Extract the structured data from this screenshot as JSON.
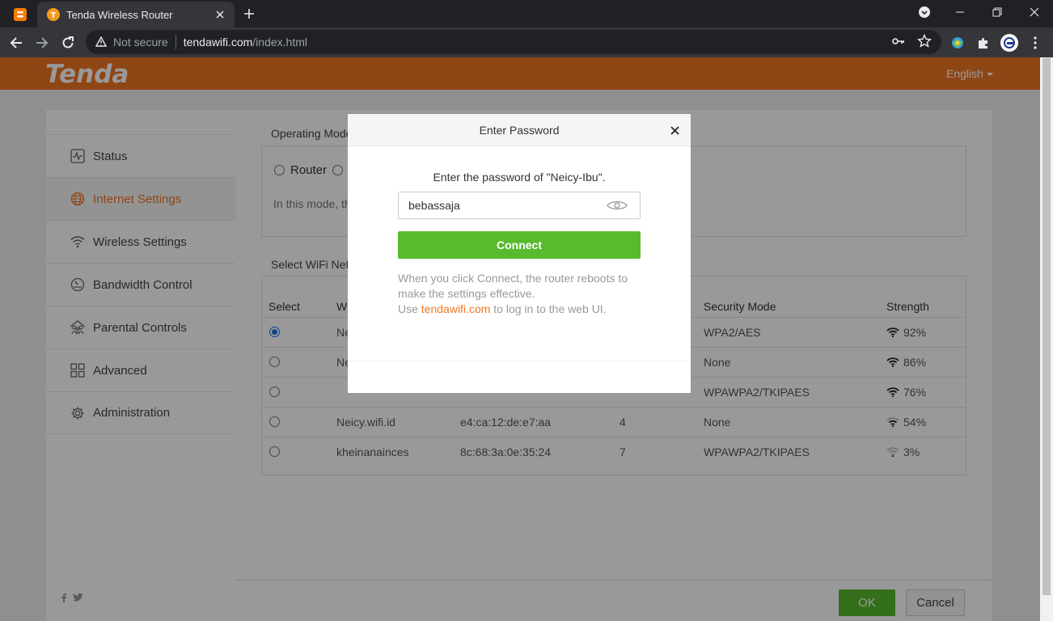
{
  "browser": {
    "tab_title": "Tenda Wireless Router",
    "security_label": "Not secure",
    "url_host": "tendawifi.com",
    "url_path": "/index.html"
  },
  "header": {
    "logo": "Tenda",
    "language": "English"
  },
  "sidebar": {
    "items": [
      {
        "label": "Status",
        "icon": "status-icon"
      },
      {
        "label": "Internet Settings",
        "icon": "globe-icon",
        "active": true
      },
      {
        "label": "Wireless Settings",
        "icon": "wifi-icon"
      },
      {
        "label": "Bandwidth Control",
        "icon": "gauge-icon"
      },
      {
        "label": "Parental Controls",
        "icon": "family-icon"
      },
      {
        "label": "Advanced",
        "icon": "grid-icon"
      },
      {
        "label": "Administration",
        "icon": "gear-icon"
      }
    ]
  },
  "main": {
    "operating_mode_title": "Operating Mode",
    "mode_router_label": "Router",
    "mode_hint": "In this mode, th",
    "wifi_section_title": "Select WiFi Net",
    "table": {
      "headers": {
        "select": "Select",
        "name": "W",
        "security": "Security Mode",
        "strength": "Strength"
      },
      "rows": [
        {
          "name": "Ne",
          "mac": "",
          "channel": "",
          "security": "WPA2/AES",
          "strength": "92%",
          "selected": true,
          "level": 4
        },
        {
          "name": "Ne",
          "mac": "",
          "channel": "",
          "security": "None",
          "strength": "86%",
          "selected": false,
          "level": 4
        },
        {
          "name": "",
          "mac": "",
          "channel": "",
          "security": "WPAWPA2/TKIPAES",
          "strength": "76%",
          "selected": false,
          "level": 4
        },
        {
          "name": "Neicy.wifi.id",
          "mac": "e4:ca:12:de:e7:aa",
          "channel": "4",
          "security": "None",
          "strength": "54%",
          "selected": false,
          "level": 3
        },
        {
          "name": "kheinanainces",
          "mac": "8c:68:3a:0e:35:24",
          "channel": "7",
          "security": "WPAWPA2/TKIPAES",
          "strength": "3%",
          "selected": false,
          "level": 1
        }
      ]
    },
    "ok_label": "OK",
    "cancel_label": "Cancel"
  },
  "modal": {
    "title": "Enter Password",
    "prompt": "Enter the password of \"Neicy-Ibu\".",
    "password_value": "bebassaja",
    "connect_label": "Connect",
    "note_line1": "When you click Connect, the router reboots to",
    "note_line2": "make the settings effective.",
    "note_use": "Use",
    "note_link": "tendawifi.com",
    "note_tail": "to log in to the web UI."
  },
  "colors": {
    "brand_orange": "#ee7623",
    "connect_green": "#58ba2d",
    "radio_blue": "#1a73e8"
  }
}
